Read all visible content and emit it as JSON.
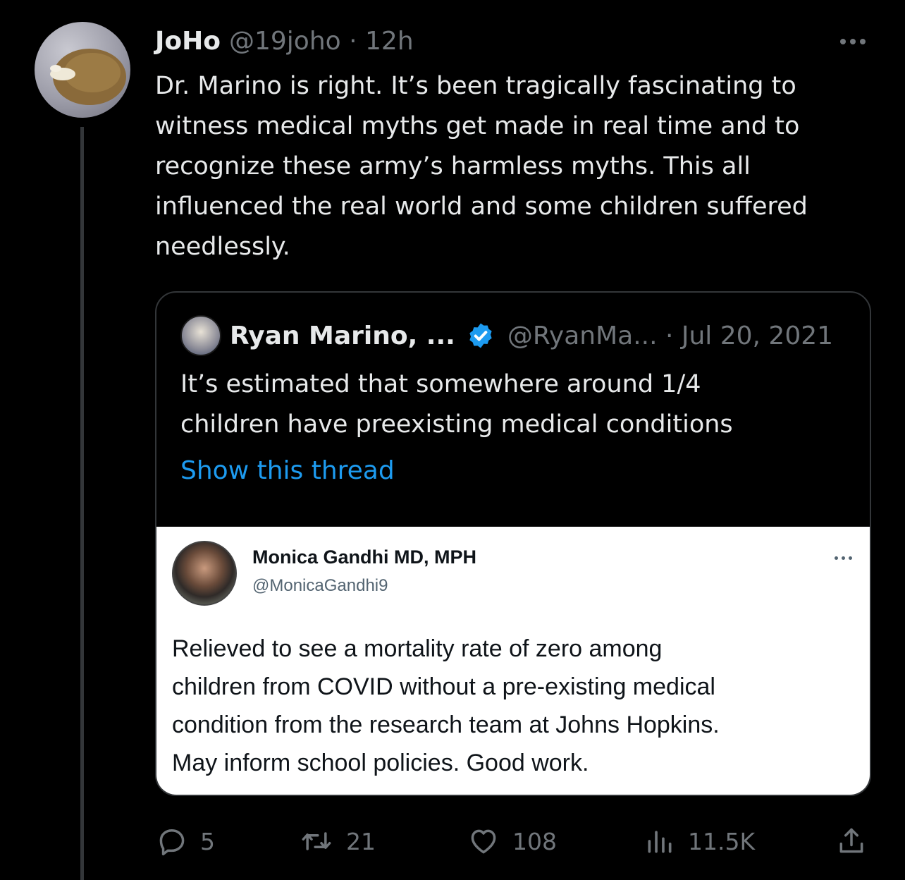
{
  "tweet": {
    "author_name": "JoHo",
    "author_handle": "@19joho",
    "meta": "@19joho · 12h",
    "text": "Dr. Marino is right. It’s been tragically fascinating to\nwitness medical myths get made in real time and to\nrecognize these army’s harmless myths.  This all\ninfluenced the real world and some children suffered\nneedlessly."
  },
  "quote": {
    "author_name": "Ryan Marino, ...",
    "meta": "@RyanMa... · Jul 20, 2021",
    "verified": true,
    "text": "It’s estimated that somewhere around 1/4\nchildren have preexisting medical conditions",
    "show_thread_label": "Show this thread",
    "embedded": {
      "author_name": "Monica Gandhi MD, MPH",
      "author_handle": "@MonicaGandhi9",
      "text": "Relieved to see a mortality rate of zero among\nchildren from COVID without a pre-existing medical\ncondition from the research team at Johns Hopkins.\nMay inform school policies. Good work."
    }
  },
  "actions": {
    "replies": "5",
    "retweets": "21",
    "likes": "108",
    "views": "11.5K"
  },
  "icons": {
    "reply": "reply-icon",
    "retweet": "retweet-icon",
    "like": "heart-icon",
    "views": "views-icon",
    "share": "share-icon",
    "more": "more-icon",
    "verified": "verified-badge-icon"
  },
  "colors": {
    "background": "#000000",
    "text": "#e7e9ea",
    "secondary": "#71767b",
    "accent": "#1d9bf0",
    "border": "#333639"
  }
}
